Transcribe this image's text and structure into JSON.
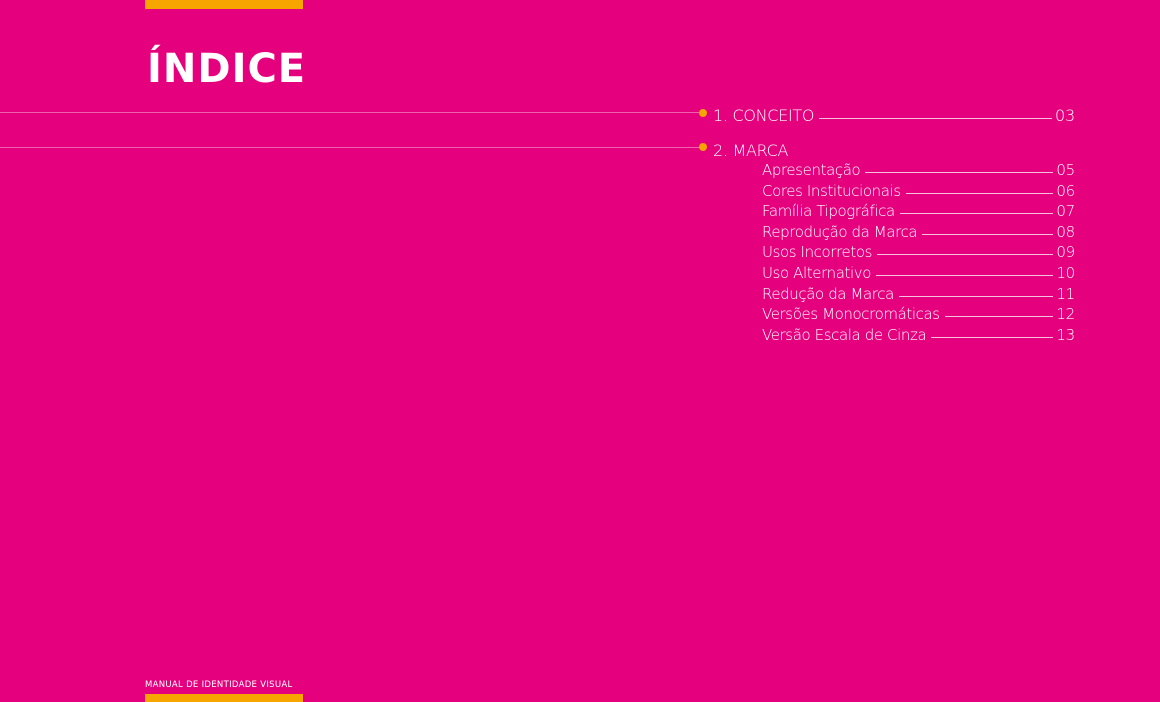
{
  "colors": {
    "background": "#e5007e",
    "accent": "#f7a600",
    "text": "#ffffff"
  },
  "header": {
    "title": "ÍNDICE"
  },
  "footer": {
    "text": "MANUAL DE IDENTIDADE VISUAL"
  },
  "toc": {
    "section1": {
      "label": "1. CONCEITO",
      "page": "03"
    },
    "section2": {
      "label": "2. MARCA",
      "items": [
        {
          "label": "Apresentação",
          "page": "05"
        },
        {
          "label": "Cores Institucionais",
          "page": "06"
        },
        {
          "label": "Família Tipográfica",
          "page": "07"
        },
        {
          "label": "Reprodução da Marca",
          "page": "08"
        },
        {
          "label": "Usos Incorretos",
          "page": "09"
        },
        {
          "label": "Uso Alternativo",
          "page": "10"
        },
        {
          "label": "Redução da Marca",
          "page": "11"
        },
        {
          "label": "Versões Monocromáticas",
          "page": "12"
        },
        {
          "label": "Versão Escala de Cinza",
          "page": "13"
        }
      ]
    }
  }
}
